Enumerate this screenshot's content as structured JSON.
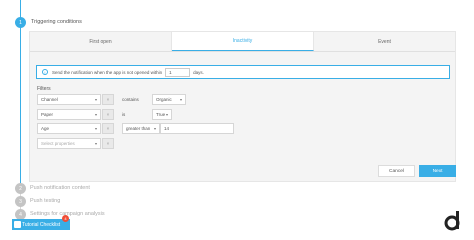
{
  "steps": [
    {
      "number": "1",
      "title": "Triggering conditions"
    },
    {
      "number": "2",
      "title": "Push notification content"
    },
    {
      "number": "3",
      "title": "Push testing"
    },
    {
      "number": "4",
      "title": "Settings for campaign analysis"
    }
  ],
  "tabs": [
    {
      "label": "First open"
    },
    {
      "label": "Inactivity"
    },
    {
      "label": "Event"
    }
  ],
  "notification": {
    "text_before": "Send the notification when the app is not opened within",
    "days_value": "1",
    "text_after": "days."
  },
  "filters": {
    "label": "Filters",
    "rows": [
      {
        "property": "Channel",
        "operator": "contains",
        "value": "Organic"
      },
      {
        "property": "Paper",
        "operator": "is",
        "value": "True"
      },
      {
        "property": "Age",
        "operator": "greater than",
        "value": "14"
      }
    ],
    "select_placeholder": "Select properties"
  },
  "buttons": {
    "cancel": "Cancel",
    "next": "Next"
  },
  "tutorial": {
    "label": "Tutorial Checklist",
    "badge": "4"
  },
  "colors": {
    "accent": "#39aee6",
    "badge": "#f04e37"
  }
}
